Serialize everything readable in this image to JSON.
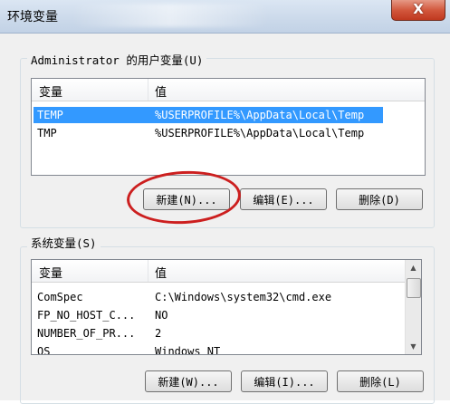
{
  "window": {
    "title": "环境变量",
    "close_glyph": "X"
  },
  "user_vars": {
    "group_label": "Administrator 的用户变量(U)",
    "col_name": "变量",
    "col_value": "值",
    "rows": [
      {
        "name": "TEMP",
        "value": "%USERPROFILE%\\AppData\\Local\\Temp",
        "selected": true
      },
      {
        "name": "TMP",
        "value": "%USERPROFILE%\\AppData\\Local\\Temp",
        "selected": false
      }
    ],
    "buttons": {
      "new": "新建(N)...",
      "edit": "编辑(E)...",
      "delete": "删除(D)"
    }
  },
  "system_vars": {
    "group_label": "系统变量(S)",
    "col_name": "变量",
    "col_value": "值",
    "rows": [
      {
        "name": "ComSpec",
        "value": "C:\\Windows\\system32\\cmd.exe"
      },
      {
        "name": "FP_NO_HOST_C...",
        "value": "NO"
      },
      {
        "name": "NUMBER_OF_PR...",
        "value": "2"
      },
      {
        "name": "OS",
        "value": "Windows_NT"
      }
    ],
    "buttons": {
      "new": "新建(W)...",
      "edit": "编辑(I)...",
      "delete": "删除(L)"
    }
  },
  "colors": {
    "selection": "#3399ff",
    "highlight_circle": "#cc1f1f"
  }
}
